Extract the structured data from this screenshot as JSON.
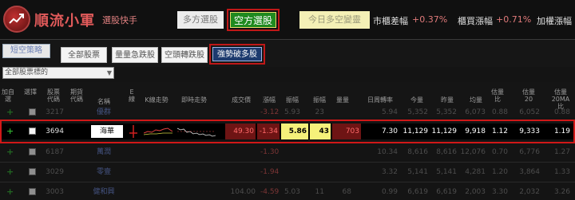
{
  "app": {
    "name": "順流小軍",
    "subtitle": "選股快手"
  },
  "top_tabs": {
    "long": "多方選股",
    "short": "空方選股",
    "today_label": "今日多空變靈"
  },
  "indices": {
    "idx1_label": "市櫃差幅",
    "idx1_value": "+0.37%",
    "idx2_label": "櫃買漲幅",
    "idx2_value": "+0.71%",
    "idx3_label": "加權漲幅"
  },
  "strategy": {
    "label": "短空策略"
  },
  "filters": {
    "f1": "全部股票",
    "f2": "量量急跌股",
    "f3": "空頭轉跌股",
    "f4": "強勢破多股"
  },
  "select": {
    "value": "全部股票標的"
  },
  "headers": {
    "add": "加自選",
    "sel": "選擇",
    "code": "股票代碼",
    "period": "期貨代碼",
    "name": "名稱",
    "e": "E線",
    "kline": "K線走勢",
    "intraday": "即時走勢",
    "turnover": "成交價",
    "change": "漲幅",
    "dd": "振幅",
    "vol_ratio": "振幅",
    "volume": "量量",
    "turnover_rate": "日周轉率",
    "today_vol": "今量",
    "yest_vol": "昨量",
    "avg_vol": "均量",
    "est_ratio": "估量比",
    "est_20": "估量20",
    "est_20_ratio": "估量20MA比"
  },
  "rows": [
    {
      "code": "3217",
      "name": "優群",
      "price": "",
      "chg": "-3.12",
      "amp": "5.93",
      "amp2": "23",
      "volume": "",
      "turn": "5.94",
      "tv": "5,352",
      "yv": "5,352",
      "av": "6,073",
      "er": "0.88",
      "e20": "6,052",
      "e20r": "0.88"
    },
    {
      "code": "3694",
      "name": "海華",
      "price": "49.30",
      "chg": "-1.34",
      "amp": "5.86",
      "amp2": "43",
      "volume": "703",
      "turn": "7.30",
      "tv": "11,129",
      "yv": "11,129",
      "av": "9,918",
      "er": "1.12",
      "e20": "9,333",
      "e20r": "1.19"
    },
    {
      "code": "6187",
      "name": "萬潤",
      "price": "",
      "chg": "-1.30",
      "amp": "",
      "amp2": "",
      "volume": "",
      "turn": "10.34",
      "tv": "8,616",
      "yv": "8,616",
      "av": "12,076",
      "er": "0.70",
      "e20": "6,776",
      "e20r": "1.27"
    },
    {
      "code": "3029",
      "name": "零壹",
      "price": "",
      "chg": "-1.94",
      "amp": "",
      "amp2": "",
      "volume": "",
      "turn": "3.32",
      "tv": "5,141",
      "yv": "5,141",
      "av": "4,281",
      "er": "1.20",
      "e20": "3,864",
      "e20r": "1.33"
    },
    {
      "code": "3003",
      "name": "健和興",
      "price": "104.00",
      "chg": "-4.59",
      "amp": "5.03",
      "amp2": "11",
      "volume": "68",
      "turn": "0.99",
      "tv": "6,619",
      "yv": "6,619",
      "av": "2,003",
      "er": "3.30",
      "e20": "2,032",
      "e20r": "3.26"
    }
  ]
}
